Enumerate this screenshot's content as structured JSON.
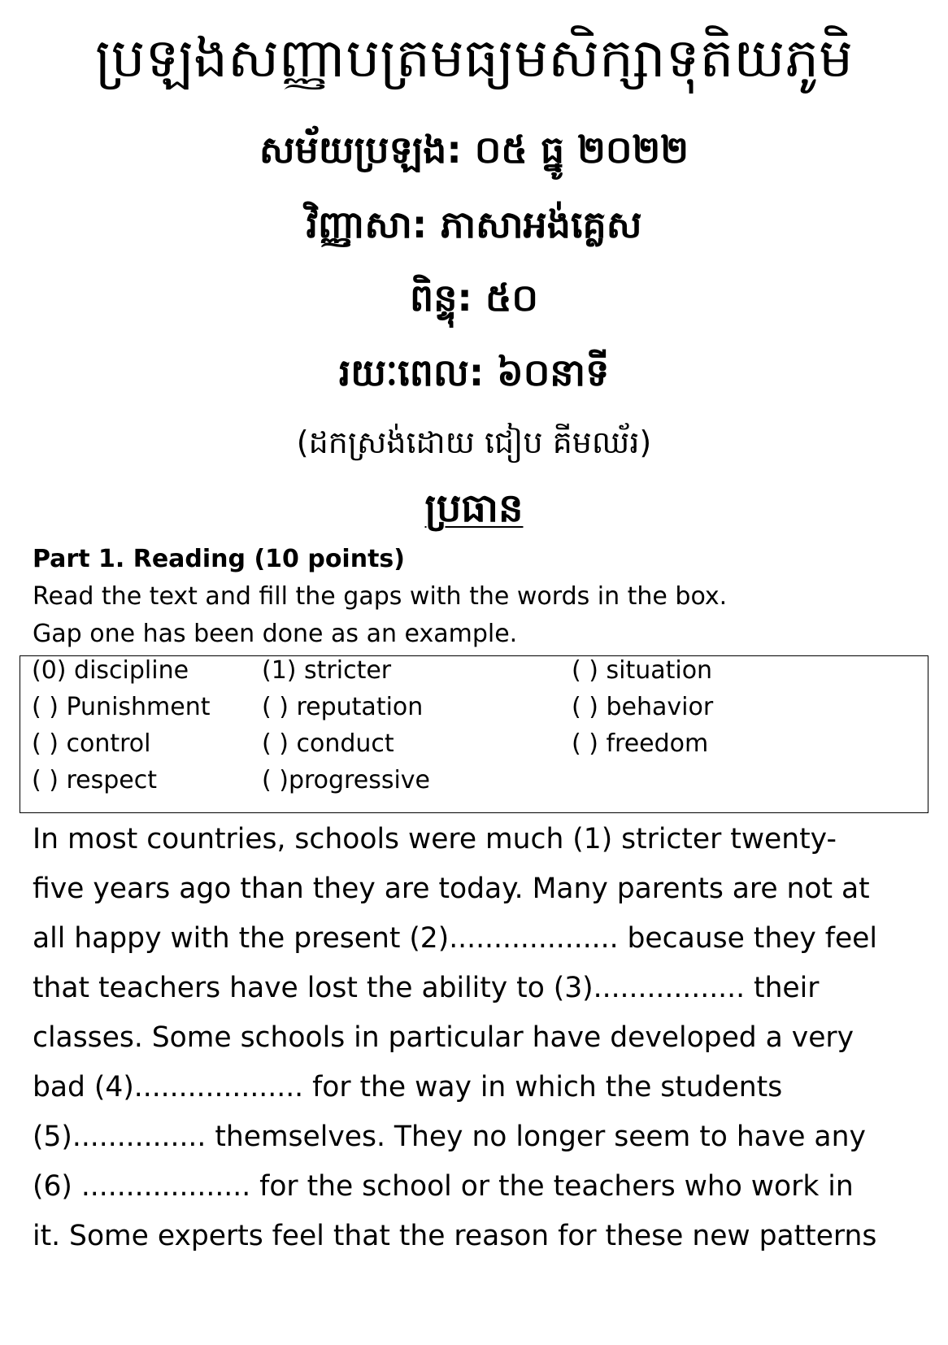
{
  "header": {
    "title": "ប្រឡងសញ្ញាបត្រមធ្យមសិក្សាទុតិយភូមិ",
    "exam_date": "សម័យប្រឡង: ០៥ ធ្នូ ២០២២",
    "subject": "វិញ្ញាសា: ភាសាអង់គ្លេស",
    "score": "ពិន្ទុ: ៥០",
    "duration": "រយៈពេល: ៦០នាទី",
    "author": "(ដកស្រង់ដោយ ជៀប គីមឈ័រ)",
    "exam_heading": "ប្រធាន"
  },
  "part1": {
    "title": "Part 1. Reading (10 points)",
    "instruction_1": "Read the text and fill the gaps with the words in the box.",
    "instruction_2": "Gap one has been done as an example.",
    "word_box": [
      [
        "(0) discipline",
        "(1) stricter",
        "( ) situation"
      ],
      [
        "( ) Punishment",
        "( ) reputation",
        "( ) behavior"
      ],
      [
        "( ) control",
        "( ) conduct",
        "( ) freedom"
      ],
      [
        "( ) respect",
        "( )progressive",
        ""
      ]
    ],
    "passage_lines": [
      "In most countries, schools were much (1) stricter twenty-",
      "five years ago than they are today. Many parents are not at",
      "all happy with the present (2)................... because they feel",
      "that teachers have lost the ability to (3)................. their",
      "classes. Some schools in particular have developed a very",
      "bad (4)................... for the way in which the students",
      "(5)............... themselves. They no longer seem to have any",
      "(6) ................... for the school or the teachers who work in",
      "it. Some experts feel that the reason for these new patterns"
    ]
  }
}
